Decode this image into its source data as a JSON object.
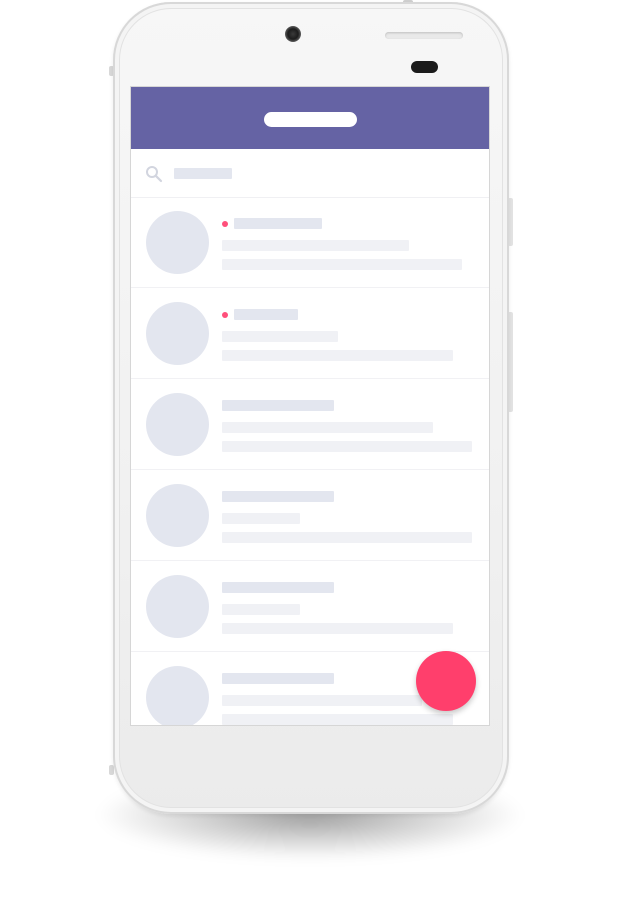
{
  "app": {
    "title": "",
    "accent_color": "#6563a4",
    "fab_color": "#ff3f6c",
    "unread_color": "#ff4f7b"
  },
  "search": {
    "placeholder": "",
    "icon": "search-icon"
  },
  "conversations": [
    {
      "unread": true
    },
    {
      "unread": true
    },
    {
      "unread": false
    },
    {
      "unread": false
    },
    {
      "unread": false
    },
    {
      "unread": false
    }
  ],
  "fab": {
    "icon": "compose-icon",
    "label": ""
  }
}
